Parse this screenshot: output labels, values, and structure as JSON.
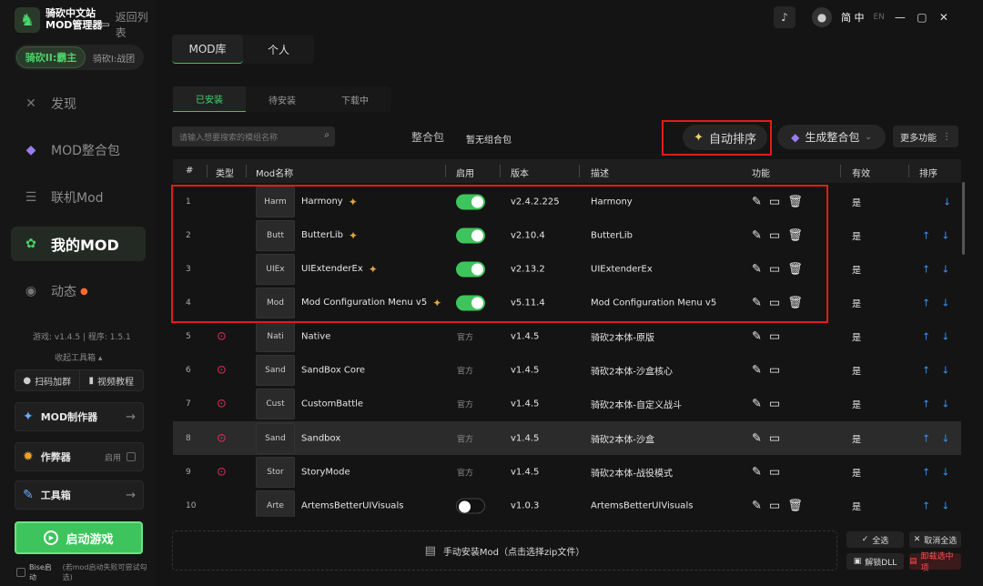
{
  "app": {
    "logo_line1": "骑砍中文站",
    "logo_line2": "MOD管理器",
    "back": "返回列表"
  },
  "game": {
    "active": "骑砍II:霸主",
    "other": "骑砍I:战团"
  },
  "nav": [
    {
      "label": "发现",
      "icon": "compass-icon"
    },
    {
      "label": "MOD整合包",
      "icon": "diamond-icon"
    },
    {
      "label": "联机Mod",
      "icon": "server-icon"
    },
    {
      "label": "我的MOD",
      "icon": "mod-icon"
    },
    {
      "label": "动态",
      "icon": "chat-icon"
    }
  ],
  "version": "游戏: v1.4.5 | 程序: 1.5.1",
  "collapse": "收起工具箱 ▴",
  "small": {
    "scan": "扫码加群",
    "video": "视频教程"
  },
  "tools": {
    "maker": "MOD制作器",
    "cheat": "作弊器",
    "cheat_enable": "启用",
    "toolbox": "工具箱"
  },
  "start": "启动游戏",
  "bise": "Bise启动",
  "bise_note": "(若mod启动失败可尝试勾选)",
  "top": {
    "lang_zh": "简 中",
    "lang_en": "EN"
  },
  "tabs1": [
    "MOD库",
    "个人"
  ],
  "tabs2": [
    "已安装",
    "待安装",
    "下载中"
  ],
  "search_placeholder": "请输入想要搜索的模组名称",
  "pack_label": "整合包",
  "pack_value": "暂无组合包",
  "autosort": "自动排序",
  "generate": "生成整合包",
  "more": "更多功能",
  "headers": {
    "num": "#",
    "type": "类型",
    "name": "Mod名称",
    "enable": "启用",
    "version": "版本",
    "desc": "描述",
    "func": "功能",
    "valid": "有效",
    "sort": "排序"
  },
  "rows": [
    {
      "n": "1",
      "thumb": "Harm",
      "name": "Harmony",
      "ver": "v2.4.2.225",
      "desc": "Harmony",
      "valid": "是"
    },
    {
      "n": "2",
      "thumb": "Butt",
      "name": "ButterLib",
      "ver": "v2.10.4",
      "desc": "ButterLib",
      "valid": "是"
    },
    {
      "n": "3",
      "thumb": "UIEx",
      "name": "UIExtenderEx",
      "ver": "v2.13.2",
      "desc": "UIExtenderEx",
      "valid": "是"
    },
    {
      "n": "4",
      "thumb": "Mod",
      "name": "Mod Configuration Menu v5",
      "ver": "v5.11.4",
      "desc": "Mod Configuration Menu v5",
      "valid": "是"
    },
    {
      "n": "5",
      "thumb": "Nati",
      "name": "Native",
      "off": "官方",
      "ver": "v1.4.5",
      "desc": "骑砍2本体-原版",
      "valid": "是"
    },
    {
      "n": "6",
      "thumb": "Sand",
      "name": "SandBox Core",
      "off": "官方",
      "ver": "v1.4.5",
      "desc": "骑砍2本体-沙盒核心",
      "valid": "是"
    },
    {
      "n": "7",
      "thumb": "Cust",
      "name": "CustomBattle",
      "off": "官方",
      "ver": "v1.4.5",
      "desc": "骑砍2本体-自定义战斗",
      "valid": "是"
    },
    {
      "n": "8",
      "thumb": "Sand",
      "name": "Sandbox",
      "off": "官方",
      "ver": "v1.4.5",
      "desc": "骑砍2本体-沙盒",
      "valid": "是"
    },
    {
      "n": "9",
      "thumb": "Stor",
      "name": "StoryMode",
      "off": "官方",
      "ver": "v1.4.5",
      "desc": "骑砍2本体-战役模式",
      "valid": "是"
    },
    {
      "n": "10",
      "thumb": "Arte",
      "name": "ArtemsBetterUIVisuals",
      "ver": "v1.0.3",
      "desc": "ArtemsBetterUIVisuals",
      "valid": "是"
    }
  ],
  "manual": "手动安装Mod（点击选择zip文件）",
  "actions": {
    "select_all": "全选",
    "deselect": "取消全选",
    "unlock": "解锁DLL",
    "uninstall": "卸载选中项"
  }
}
